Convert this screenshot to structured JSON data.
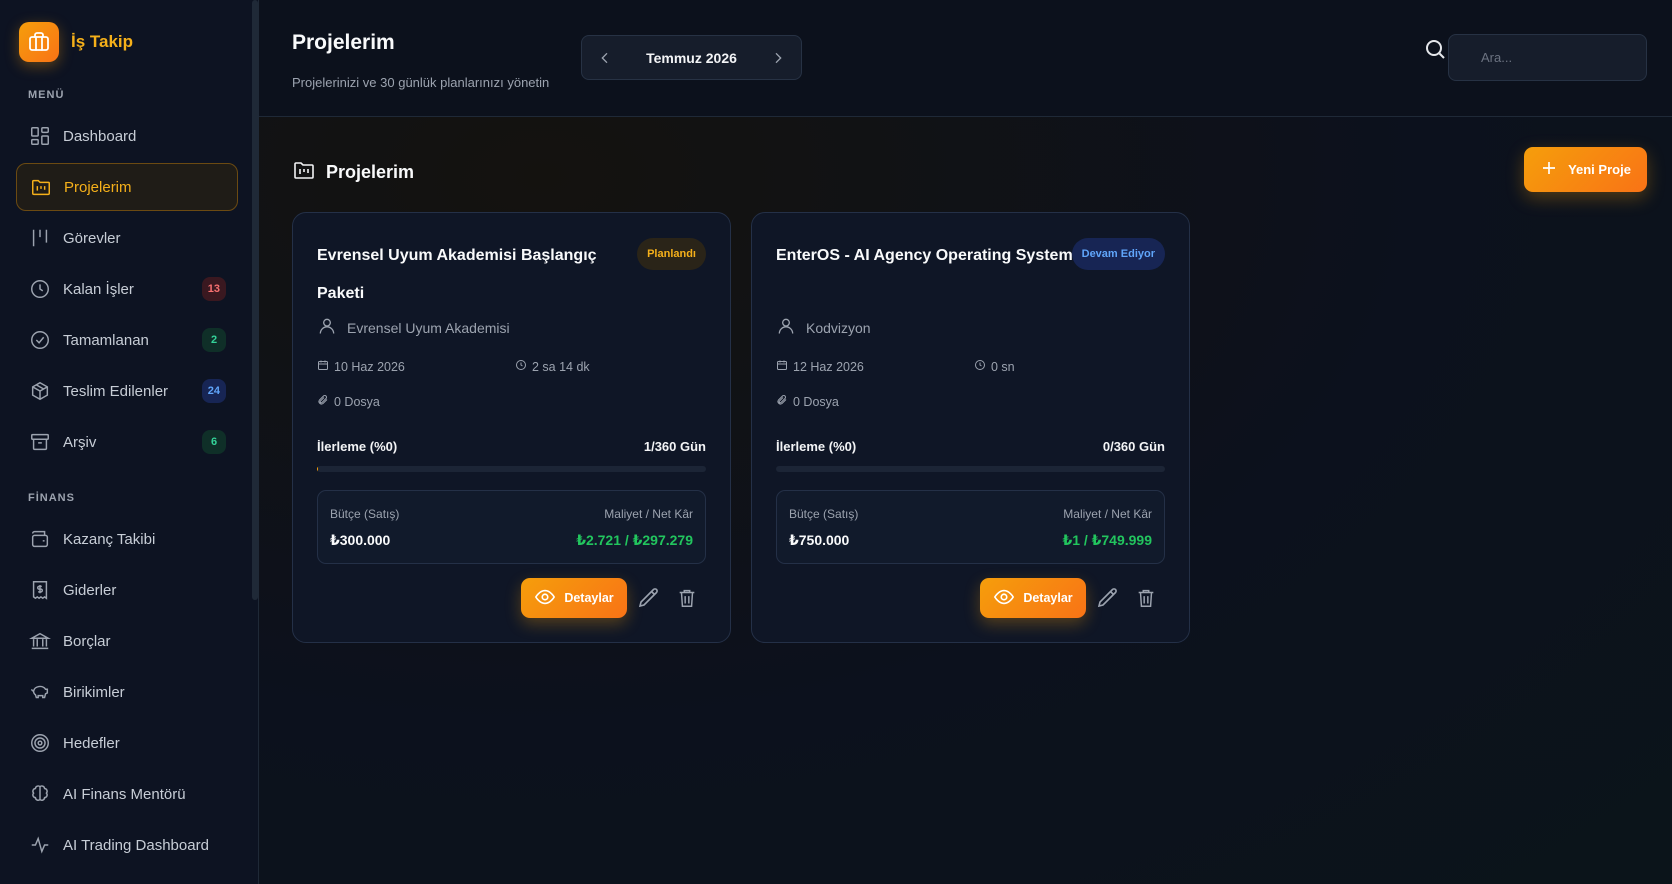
{
  "brand": {
    "name": "İş Takip",
    "icon": "briefcase-icon"
  },
  "sidebar": {
    "menu_label": "MENÜ",
    "menu_items": [
      {
        "label": "Dashboard",
        "icon": "dashboard-icon"
      },
      {
        "label": "Projelerim",
        "icon": "folder-kanban-icon",
        "active": true
      },
      {
        "label": "Görevler",
        "icon": "columns-icon"
      },
      {
        "label": "Kalan İşler",
        "icon": "clock-icon",
        "badge": "13"
      },
      {
        "label": "Tamamlanan",
        "icon": "check-circle-icon",
        "badge": "2"
      },
      {
        "label": "Teslim Edilenler",
        "icon": "package-icon",
        "badge": "24"
      },
      {
        "label": "Arşiv",
        "icon": "archive-icon",
        "badge": "6"
      }
    ],
    "finance_label": "FİNANS",
    "finance_items": [
      {
        "label": "Kazanç Takibi",
        "icon": "wallet-icon"
      },
      {
        "label": "Giderler",
        "icon": "receipt-icon"
      },
      {
        "label": "Borçlar",
        "icon": "bank-icon"
      },
      {
        "label": "Birikimler",
        "icon": "piggy-bank-icon"
      },
      {
        "label": "Hedefler",
        "icon": "target-icon"
      },
      {
        "label": "AI Finans Mentörü",
        "icon": "brain-icon"
      },
      {
        "label": "AI Trading Dashboard",
        "icon": "activity-icon"
      }
    ]
  },
  "header": {
    "title": "Projelerim",
    "subtitle": "Projelerinizi ve 30 günlük planlarınızı yönetin",
    "month": "Temmuz 2026",
    "search_placeholder": "Ara..."
  },
  "section": {
    "title": "Projelerim",
    "new_button": "Yeni Proje"
  },
  "projects": [
    {
      "title": "Evrensel Uyum Akademisi Başlangıç Paketi",
      "status": "Planlandı",
      "client": "Evrensel Uyum Akademisi",
      "date": "10 Haz 2026",
      "duration": "2 sa 14 dk",
      "files": "0 Dosya",
      "progress_label": "İlerleme (%0)",
      "progress_days": "1/360 Gün",
      "progress_fraction": 0.0028,
      "budget_label": "Bütçe (Satış)",
      "cost_label": "Maliyet / Net Kâr",
      "budget": "₺300.000",
      "cost_profit": "₺2.721 / ₺297.279",
      "details_label": "Detaylar"
    },
    {
      "title": "EnterOS - AI Agency Operating System",
      "status": "Devam Ediyor",
      "client": "Kodvizyon",
      "date": "12 Haz 2026",
      "duration": "0 sn",
      "files": "0 Dosya",
      "progress_label": "İlerleme (%0)",
      "progress_days": "0/360 Gün",
      "progress_fraction": 0,
      "budget_label": "Bütçe (Satış)",
      "cost_label": "Maliyet / Net Kâr",
      "budget": "₺750.000",
      "cost_profit": "₺1 / ₺749.999",
      "details_label": "Detaylar"
    }
  ],
  "colors": {
    "accent": "#f59e0b",
    "profit": "#22c55e",
    "info": "#60a5fa"
  }
}
